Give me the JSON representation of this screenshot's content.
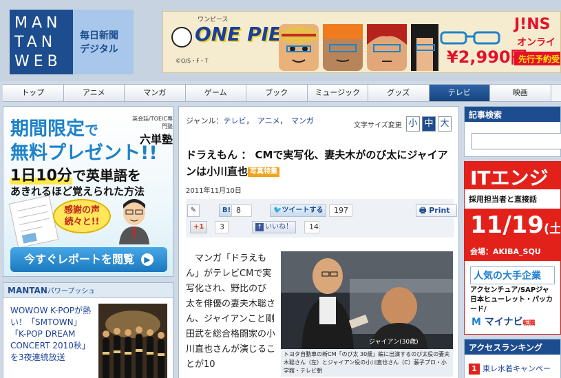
{
  "header": {
    "logo_lines": [
      "MAN",
      "TAN",
      "WEB"
    ],
    "partner_line1": "毎日新聞",
    "partner_line2": "デジタル"
  },
  "top_ad": {
    "title": "ONE PIECE",
    "kana": "ワンピース",
    "copyright": "©O/S・F・T",
    "brand": "J!NS",
    "online": "オンライン",
    "sale": "先行予約受",
    "price": "¥2,990円"
  },
  "nav": {
    "items": [
      "トップ",
      "アニメ",
      "マンガ",
      "ゲーム",
      "ブック",
      "ミュージック",
      "グッズ",
      "テレビ",
      "映画"
    ],
    "active": "テレビ"
  },
  "promo": {
    "line1": "期間限定",
    "line1_de": "で",
    "line2": "無料プレゼント!!",
    "line3_hl": "1日10分",
    "line3_rest": "で英単語を",
    "line4": "あきれるほど覚えられた方法",
    "brand_small": "英会話/TOEIC専門塾",
    "brand": "六単塾",
    "bubble": "感謝の声\n続々と!!",
    "button": "今すぐレポートを閲覧"
  },
  "power_push": {
    "title": "MANTAN",
    "title_sub": "パワープッシュ",
    "text": "WOWOW K-POPが熱い！「SMTOWN」「K-POP DREAM CONCERT 2010秋」を3夜連続放送"
  },
  "article": {
    "genre_label": "ジャンル：",
    "genres": [
      "テレビ",
      "アニメ",
      "マンガ"
    ],
    "font_size_label": "文字サイズ変更",
    "font_sizes": [
      "小",
      "中",
      "大"
    ],
    "title": "ドラえもん ： CMで実写化、妻夫木がのび太にジャイアンは小川直也",
    "badge": "写真特集",
    "date": "2011年11月10日",
    "social": {
      "hatena": "B!",
      "hatena_count": "8",
      "tweet": "ツイートする",
      "tweet_count": "197",
      "print": "Print",
      "plus": "+1",
      "plus_count": "3",
      "like": "いいね！",
      "like_count": "14"
    },
    "body": "マンガ「ドラえもん」がテレビCMで実写化され、野比のび太を俳優の妻夫木聡さん、ジャイアンこと剛田武を総合格闘家の小川直也さんが演じることが10",
    "photo_label": "ジャイアン(30歳)",
    "photo_caption": "トヨタ自動車の新CM「のび太 30歳」編に出演するのび太役の妻夫木聡さん（左）とジャイアン役の小川直也さん（C）藤子プロ・小学館・テレビ朝"
  },
  "sidebar": {
    "search_title": "記事検索",
    "it_title": "ITエンジ",
    "it_sub": "採用担当者と直接話",
    "it_date": "11/19",
    "it_date_day": "(土",
    "it_venue": "会場：AKIBA_SQU",
    "it_popular": "人気の大手企業",
    "it_companies": "アクセンチュア/SAPジャ\n日本ヒューレット・パッカード/",
    "mynavi": "マイナビ",
    "mynavi_small": "転職",
    "ranking_title": "アクセスランキング",
    "ranking_first": "東レ水着キャンペー",
    "ranking_first_num": "1"
  }
}
